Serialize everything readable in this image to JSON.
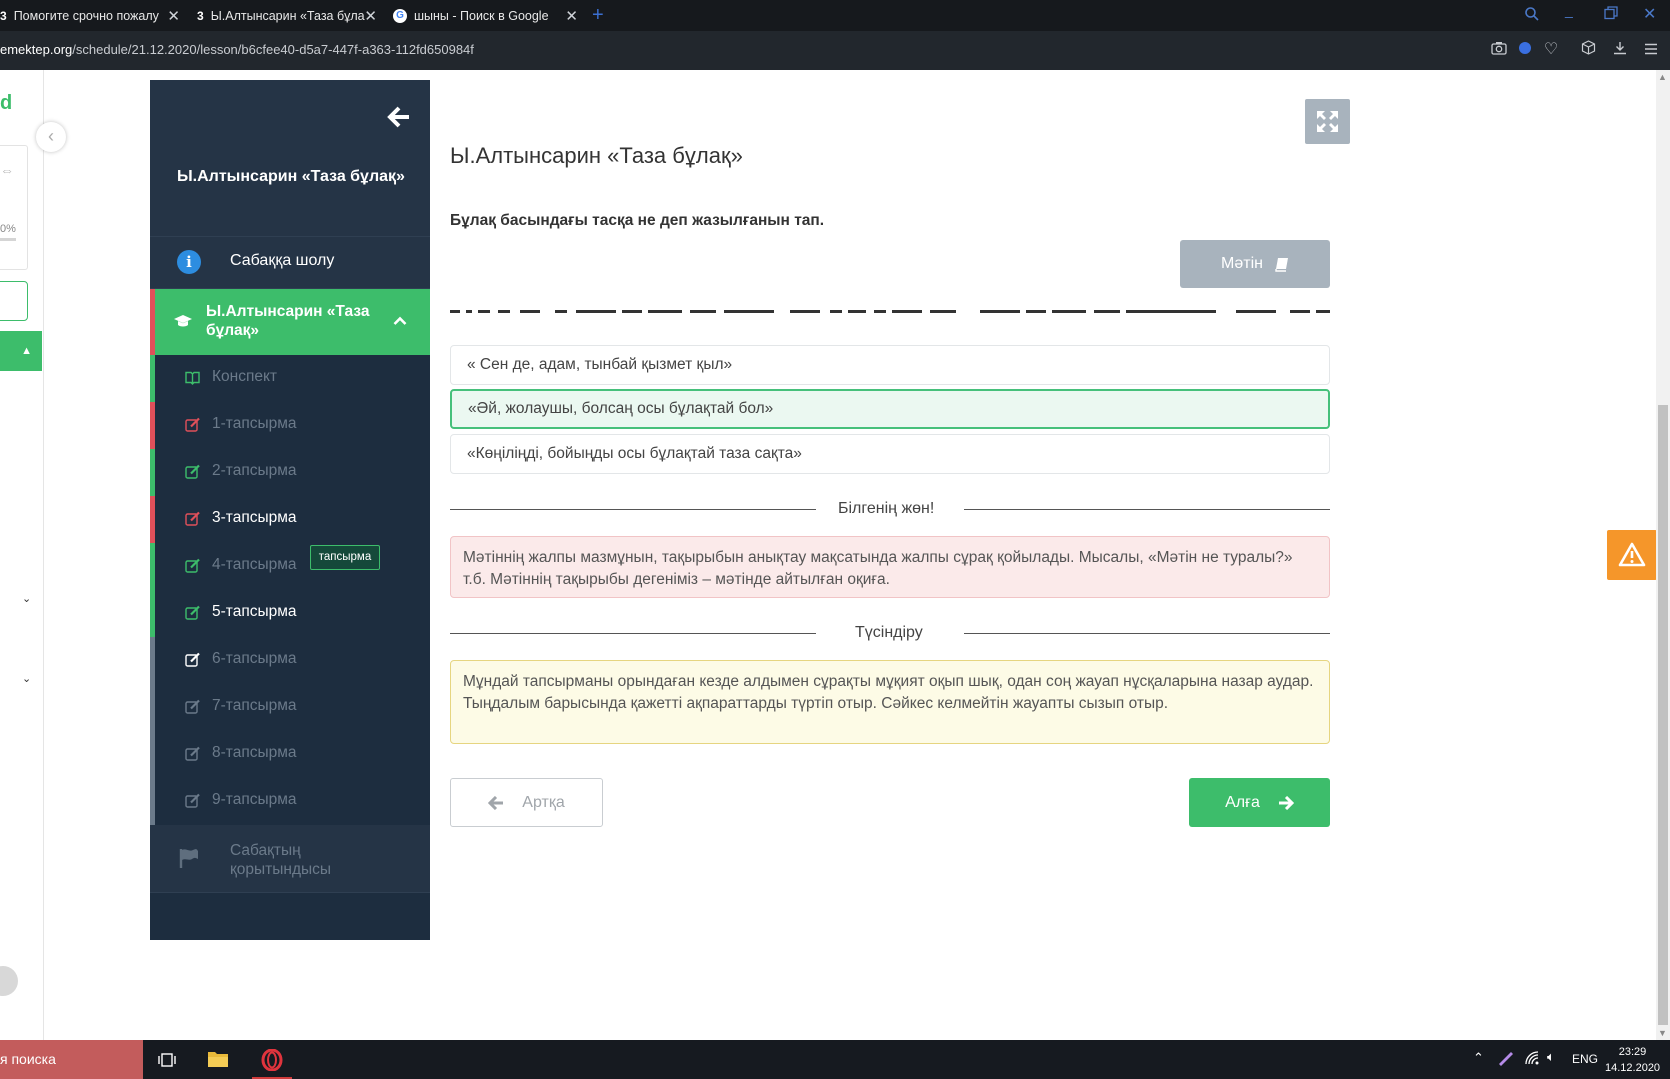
{
  "browser": {
    "tabs": [
      {
        "favicon": "3",
        "title": "Помогите срочно пожалу"
      },
      {
        "favicon": "3",
        "title": "Ы.Алтынсарин «Таза бұла"
      },
      {
        "favicon": "G",
        "title": "шыны - Поиск в Google"
      }
    ],
    "new_tab": "+",
    "url_domain": "emektep.org",
    "url_path": "/schedule/21.12.2020/lesson/b6cfee40-d5a7-447f-a363-112fd650984f"
  },
  "sidebar": {
    "lesson_title": "Ы.Алтынсарин «Таза бұлақ»",
    "overview_label": "Сабаққа шолу",
    "active_lesson_label": "Ы.Алтынсарин «Таза бұлақ»",
    "items": [
      {
        "label": "Конспект",
        "icon": "book-icon"
      },
      {
        "label": "1-тапсырма",
        "icon": "edit-icon"
      },
      {
        "label": "2-тапсырма",
        "icon": "edit-icon"
      },
      {
        "label": "3-тапсырма",
        "icon": "edit-icon"
      },
      {
        "label": "4-тапсырма",
        "icon": "edit-icon"
      },
      {
        "label": "5-тапсырма",
        "icon": "edit-icon"
      },
      {
        "label": "6-тапсырма",
        "icon": "edit-icon"
      },
      {
        "label": "7-тапсырма",
        "icon": "edit-icon"
      },
      {
        "label": "8-тапсырма",
        "icon": "edit-icon"
      },
      {
        "label": "9-тапсырма",
        "icon": "edit-icon"
      }
    ],
    "tooltip": "тапсырма",
    "conclusion_label": "Сабақтың қорытындысы"
  },
  "main": {
    "title": "Ы.Алтынсарин «Таза бұлақ»",
    "question": "Бұлақ басындағы тасқа не деп жазылғанын тап.",
    "text_button": "Мәтін",
    "options": [
      "« Сен де, адам, тынбай қызмет қыл»",
      "«Әй, жолаушы, болсаң осы бұлақтай бол»",
      "«Көңіліңді, бойыңды осы бұлақтай таза сақта»"
    ],
    "selected_option": 1,
    "tip_heading": "Білгенің жөн!",
    "tip_text": "Мәтіннің жалпы мазмұнын, тақырыбын анықтау мақсатында жалпы сұрақ қойылады. Мысалы, «Мәтін не туралы?» т.б. Мәтіннің тақырыбы дегеніміз – мәтінде айтылған оқиға.",
    "explanation_heading": "Түсіндіру",
    "explanation_text": "Мұндай тапсырманы орындаған кезде алдымен сұрақты мұқият оқып шық, одан соң жауап нұсқаларына назар аудар. Тыңдалым барысында қажетті ақпараттарды түртіп отыр. Сәйкес келмейтін жауапты сызып отыр.",
    "back_button": "Артқа",
    "next_button": "Алға"
  },
  "left_strip": {
    "progress_text": "0%"
  },
  "taskbar": {
    "search_text": "я поиска",
    "language": "ENG",
    "time": "23:29",
    "date": "14.12.2020"
  },
  "colors": {
    "green": "#3dbd6b",
    "sidebar_bg": "#1d2d3f",
    "red_marker": "#e0505a",
    "orange": "#f5962a"
  }
}
